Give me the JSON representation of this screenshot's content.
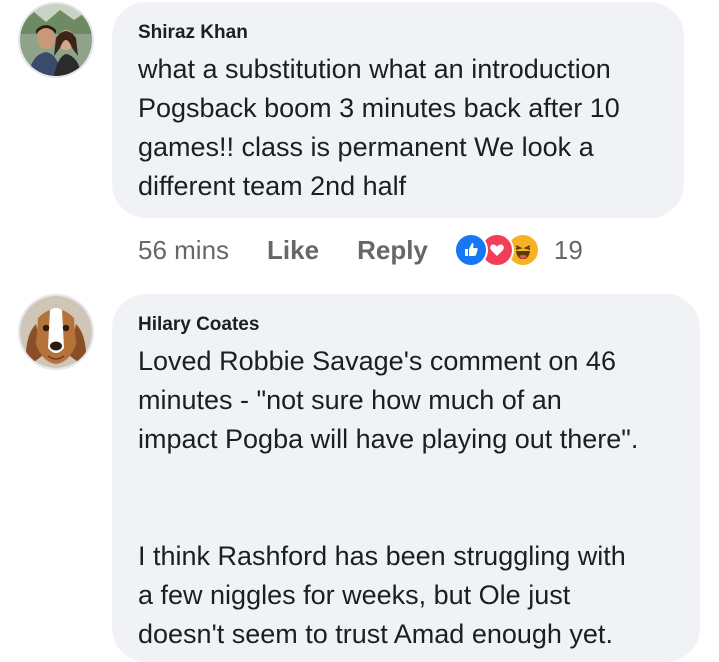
{
  "comments": [
    {
      "author": "Shiraz Khan",
      "text": "what a substitution what an introduction\nPogsback boom 3 minutes back after 10\ngames!! class is permanent We look a\ndifferent team 2nd half",
      "timestamp": "56 mins",
      "like_label": "Like",
      "reply_label": "Reply",
      "reactions": [
        "like-icon",
        "love-icon",
        "haha-icon"
      ],
      "reaction_count": "19"
    },
    {
      "author": "Hilary Coates",
      "text": "Loved Robbie Savage's comment on 46\nminutes - \"not sure how much of an\nimpact Pogba will have playing out there\".\n\n\nI think Rashford has been struggling with\na few niggles for weeks, but Ole just\ndoesn't seem to trust Amad enough yet."
    }
  ],
  "colors": {
    "bubble": "#f0f2f5",
    "secondary_text": "#65676b",
    "like_blue": "#1877f2",
    "love_red": "#f33e58",
    "haha_yellow": "#f7b125"
  }
}
